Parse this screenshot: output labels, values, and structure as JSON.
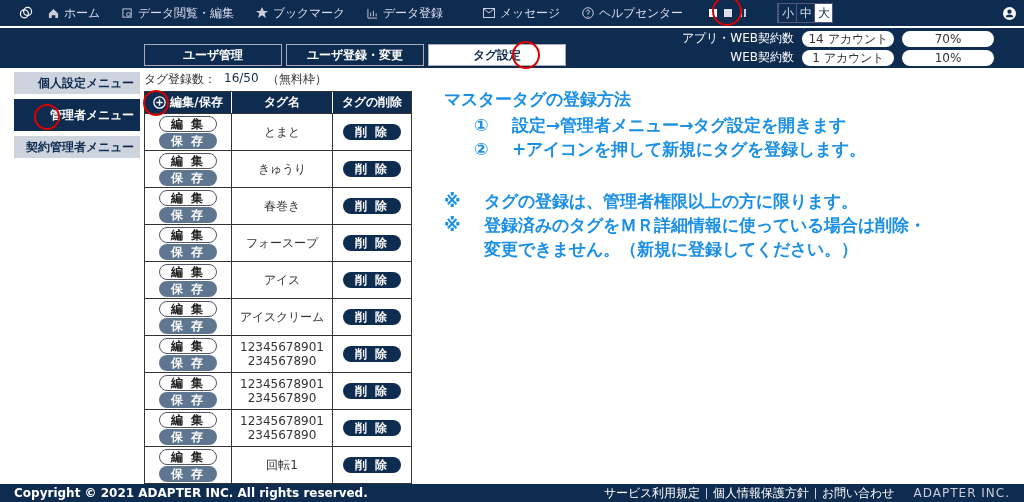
{
  "nav": {
    "left": [
      {
        "label": "ホーム"
      },
      {
        "label": "データ閲覧・編集"
      },
      {
        "label": "ブックマーク"
      },
      {
        "label": "データ登録"
      }
    ],
    "right": [
      {
        "label": "メッセージ"
      },
      {
        "label": "ヘルプセンター"
      }
    ],
    "font_sizes": [
      {
        "label": "小",
        "selected": false
      },
      {
        "label": "中",
        "selected": false
      },
      {
        "label": "大",
        "selected": true
      }
    ]
  },
  "tabs": [
    {
      "label": "ユーザ管理",
      "selected": false
    },
    {
      "label": "ユーザ登録・変更",
      "selected": false
    },
    {
      "label": "タグ設定",
      "selected": true
    }
  ],
  "stats": [
    {
      "label": "アプリ・WEB契約数",
      "accounts": "14 アカウント",
      "percent": "70%"
    },
    {
      "label": "WEB契約数",
      "accounts": "1 アカウント",
      "percent": "10%"
    }
  ],
  "sidebar": [
    {
      "label": "個人設定メニュー",
      "selected": false
    },
    {
      "label": "管理者メニュー",
      "selected": true
    },
    {
      "label": "契約管理者メニュー",
      "selected": false
    }
  ],
  "tag_count": {
    "label": "タグ登録数：",
    "value": "16/50",
    "note": "（無料枠）"
  },
  "table": {
    "columns": [
      "編集/保存",
      "タグ名",
      "タグの削除"
    ],
    "rows": [
      {
        "edit": "編 集",
        "save": "保 存",
        "name": "とまと",
        "delete": "削 除"
      },
      {
        "edit": "編 集",
        "save": "保 存",
        "name": "きゅうり",
        "delete": "削 除"
      },
      {
        "edit": "編 集",
        "save": "保 存",
        "name": "春巻き",
        "delete": "削 除"
      },
      {
        "edit": "編 集",
        "save": "保 存",
        "name": "フォースープ",
        "delete": "削 除"
      },
      {
        "edit": "編 集",
        "save": "保 存",
        "name": "アイス",
        "delete": "削 除"
      },
      {
        "edit": "編 集",
        "save": "保 存",
        "name": "アイスクリーム",
        "delete": "削 除"
      },
      {
        "edit": "編 集",
        "save": "保 存",
        "name": "12345678901\n234567890",
        "delete": "削 除"
      },
      {
        "edit": "編 集",
        "save": "保 存",
        "name": "12345678901\n234567890",
        "delete": "削 除"
      },
      {
        "edit": "編 集",
        "save": "保 存",
        "name": "12345678901\n234567890",
        "delete": "削 除"
      },
      {
        "edit": "編 集",
        "save": "保 存",
        "name": "回転1",
        "delete": "削 除"
      }
    ]
  },
  "instructions": {
    "title": "マスタータグの登録方法",
    "steps": [
      {
        "mark": "①",
        "text": "設定→管理者メニュー→タグ設定を開きます"
      },
      {
        "mark": "②",
        "text": "+アイコンを押して新規にタグを登録します。"
      }
    ],
    "notes": [
      {
        "mark": "※",
        "text": "タグの登録は、管理者権限以上の方に限ります。"
      },
      {
        "mark": "※",
        "text": "登録済みのタグをＭＲ詳細情報に使っている場合は削除・変更できません。（新規に登録してください。）"
      }
    ]
  },
  "footer": {
    "copyright": "Copyright © 2021 ADAPTER INC. All rights reserved.",
    "links": [
      "サービス利用規定",
      "個人情報保護方針",
      "お問い合わせ"
    ],
    "logo": "ADAPTER INC."
  }
}
